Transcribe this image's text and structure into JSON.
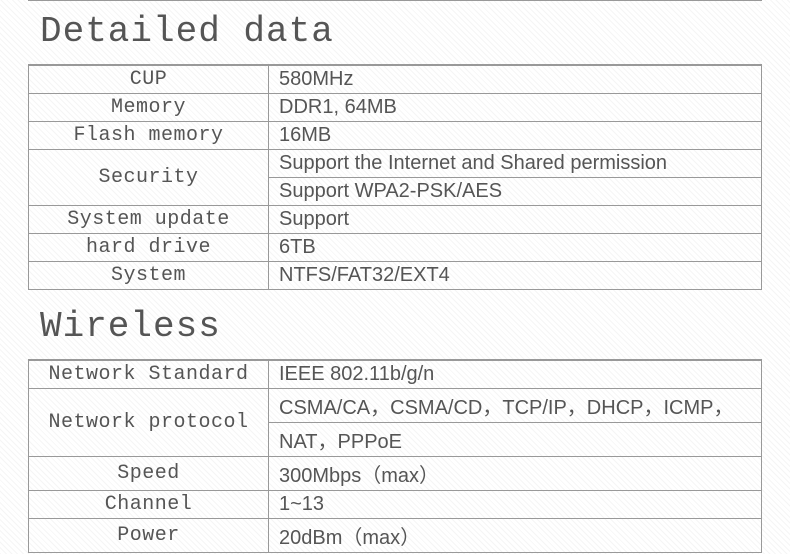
{
  "sections": {
    "detailed": {
      "title": "Detailed data",
      "rows": {
        "cup": {
          "label": "CUP",
          "value": "580MHz"
        },
        "memory": {
          "label": "Memory",
          "value": "DDR1, 64MB"
        },
        "flash": {
          "label": "Flash memory",
          "value": "16MB"
        },
        "security": {
          "label": "Security",
          "values": [
            "Support the Internet and Shared permission",
            "Support WPA2-PSK/AES"
          ]
        },
        "update": {
          "label": "System update",
          "value": "Support"
        },
        "hdd": {
          "label": "hard drive",
          "value": "6TB"
        },
        "system": {
          "label": "System",
          "value": "NTFS/FAT32/EXT4"
        }
      }
    },
    "wireless": {
      "title": "Wireless",
      "rows": {
        "standard": {
          "label": "Network Standard",
          "value": "IEEE 802.11b/g/n"
        },
        "protocol": {
          "label": "Network protocol",
          "values": [
            "CSMA/CA，CSMA/CD，TCP/IP，DHCP，ICMP，",
            "NAT，PPPoE"
          ]
        },
        "speed": {
          "label": "Speed",
          "value": "300Mbps（max）"
        },
        "channel": {
          "label": "Channel",
          "value": "1~13"
        },
        "power": {
          "label": "Power",
          "value": "20dBm（max）"
        }
      }
    }
  }
}
